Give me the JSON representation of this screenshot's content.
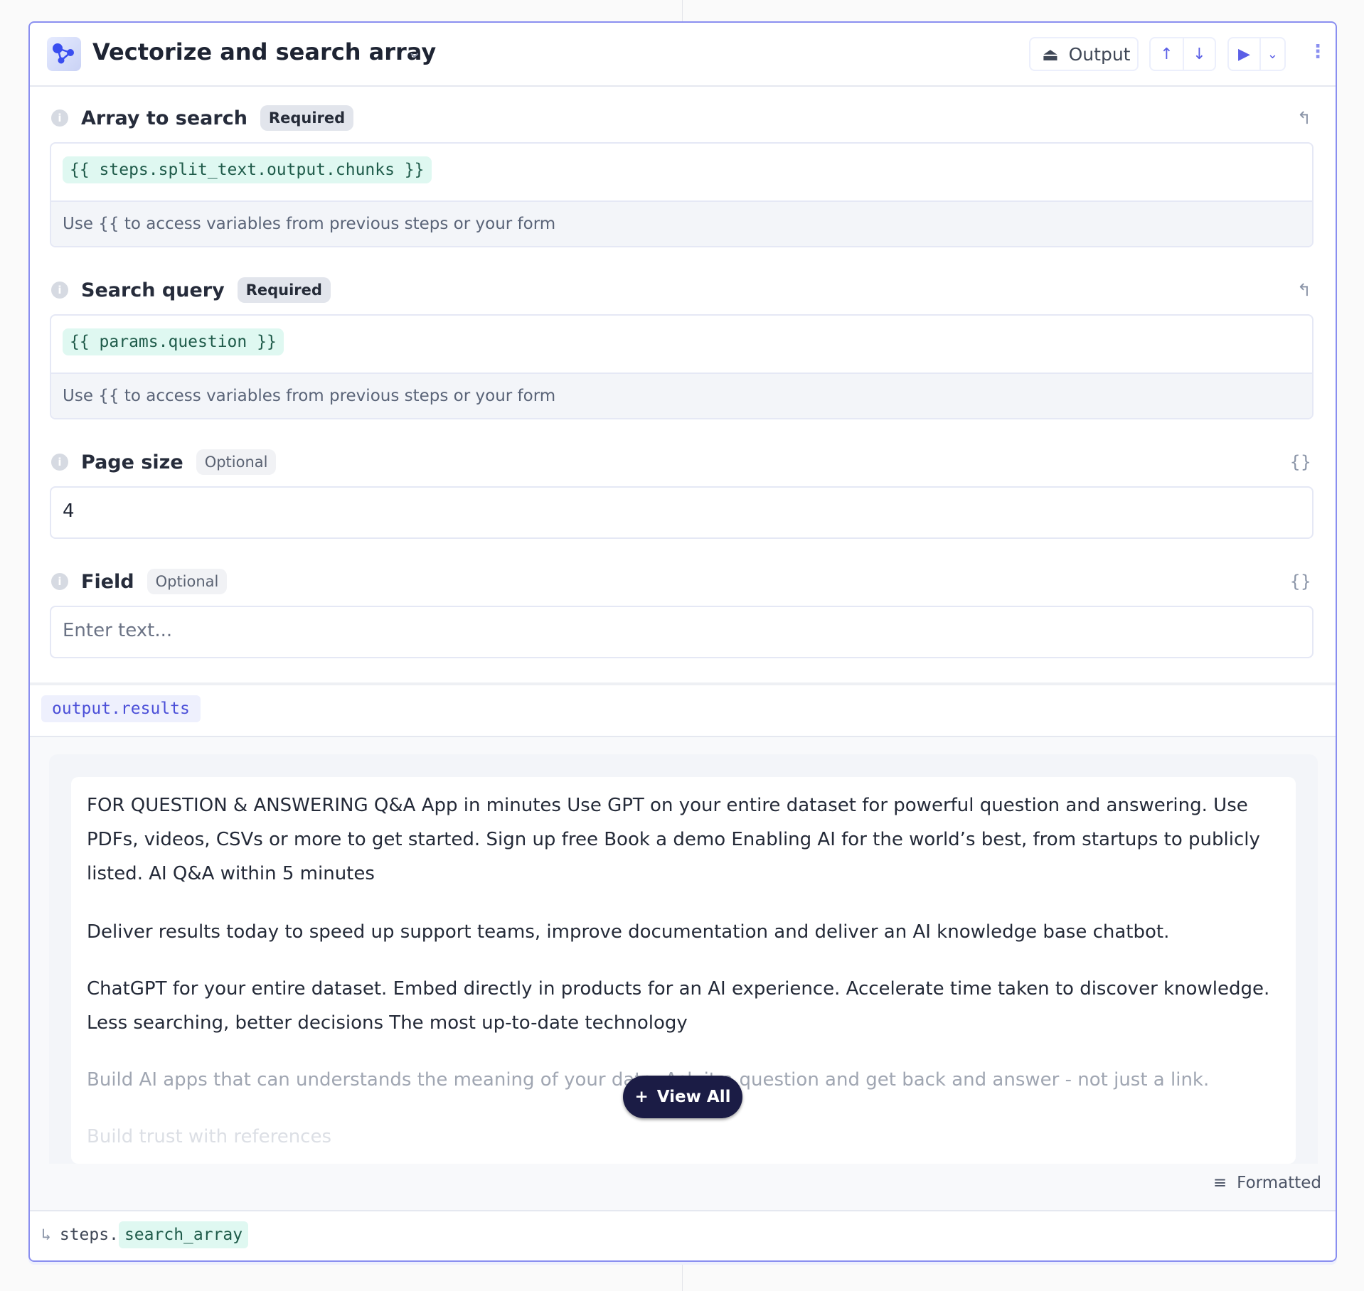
{
  "header": {
    "title": "Vectorize and search array",
    "output_label": "Output"
  },
  "fields": [
    {
      "label": "Array to search",
      "badge": "Required",
      "value": "{{ steps.split_text.output.chunks }}",
      "hint": "Use {{ to access variables from previous steps or your form"
    },
    {
      "label": "Search query",
      "badge": "Required",
      "value": "{{ params.question }}",
      "hint": "Use {{ to access variables from previous steps or your form"
    },
    {
      "label": "Page size",
      "badge": "Optional",
      "value": "4"
    },
    {
      "label": "Field",
      "badge": "Optional",
      "placeholder": "Enter text..."
    }
  ],
  "output": {
    "path": "output.results",
    "paragraphs": [
      "FOR QUESTION & ANSWERING Q&A App in minutes Use GPT on your entire dataset for powerful question and answering. Use PDFs, videos, CSVs or more to get started. Sign up free   Book a demo Enabling AI for the world’s best, from startups to publicly listed. AI Q&A within 5 minutes",
      "Deliver results today to speed up support teams, improve documentation and deliver an AI knowledge base chatbot.",
      "ChatGPT for your entire dataset. Embed directly in products for an AI experience. Accelerate time taken to discover knowledge. Less searching, better decisions The most up-to-date technology",
      "Build AI apps that can understands the meaning of your data. Ask it a question and get back and answer - not just a link.",
      "Build trust with references"
    ],
    "view_all": "View All",
    "format": "Formatted"
  },
  "footer": {
    "prefix": "steps.",
    "name": "search_array"
  },
  "colors": {
    "accent": "#5b5fe6",
    "border": "#8a8ff0",
    "chip": "#dff8f1",
    "dark_button": "#1b1c45"
  }
}
